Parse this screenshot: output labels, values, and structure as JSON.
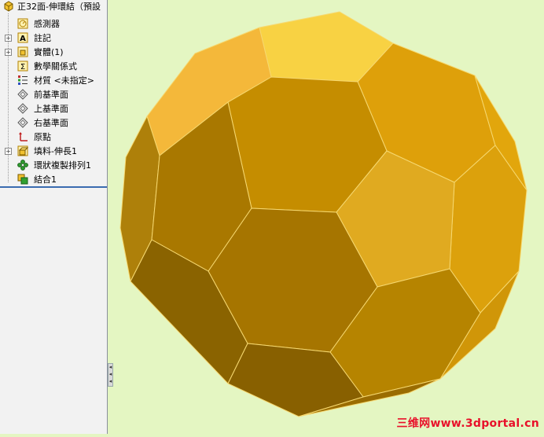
{
  "tree": {
    "items": [
      {
        "label": "正32面-伸環結（預設",
        "icon": "part-icon"
      },
      {
        "label": "感測器",
        "icon": "sensor-icon"
      },
      {
        "label": "註記",
        "icon": "annotation-icon"
      },
      {
        "label": "實體(1)",
        "icon": "solid-bodies-icon"
      },
      {
        "label": "數學關係式",
        "icon": "equations-icon"
      },
      {
        "label": "材質 <未指定>",
        "icon": "material-icon"
      },
      {
        "label": "前基準面",
        "icon": "plane-icon"
      },
      {
        "label": "上基準面",
        "icon": "plane-icon"
      },
      {
        "label": "右基準面",
        "icon": "plane-icon"
      },
      {
        "label": "原點",
        "icon": "origin-icon"
      },
      {
        "label": "填料-伸長1",
        "icon": "extrude-icon"
      },
      {
        "label": "環狀複製排列1",
        "icon": "circular-pattern-icon"
      },
      {
        "label": "結合1",
        "icon": "combine-icon"
      }
    ],
    "expand_symbol": "+"
  },
  "splitter": {
    "arrows": [
      "◂",
      "◂",
      "◂"
    ]
  },
  "viewport": {
    "background": "#e4f6c2",
    "model_color": "#d4a017"
  },
  "watermark": "三维网www.3dportal.cn"
}
